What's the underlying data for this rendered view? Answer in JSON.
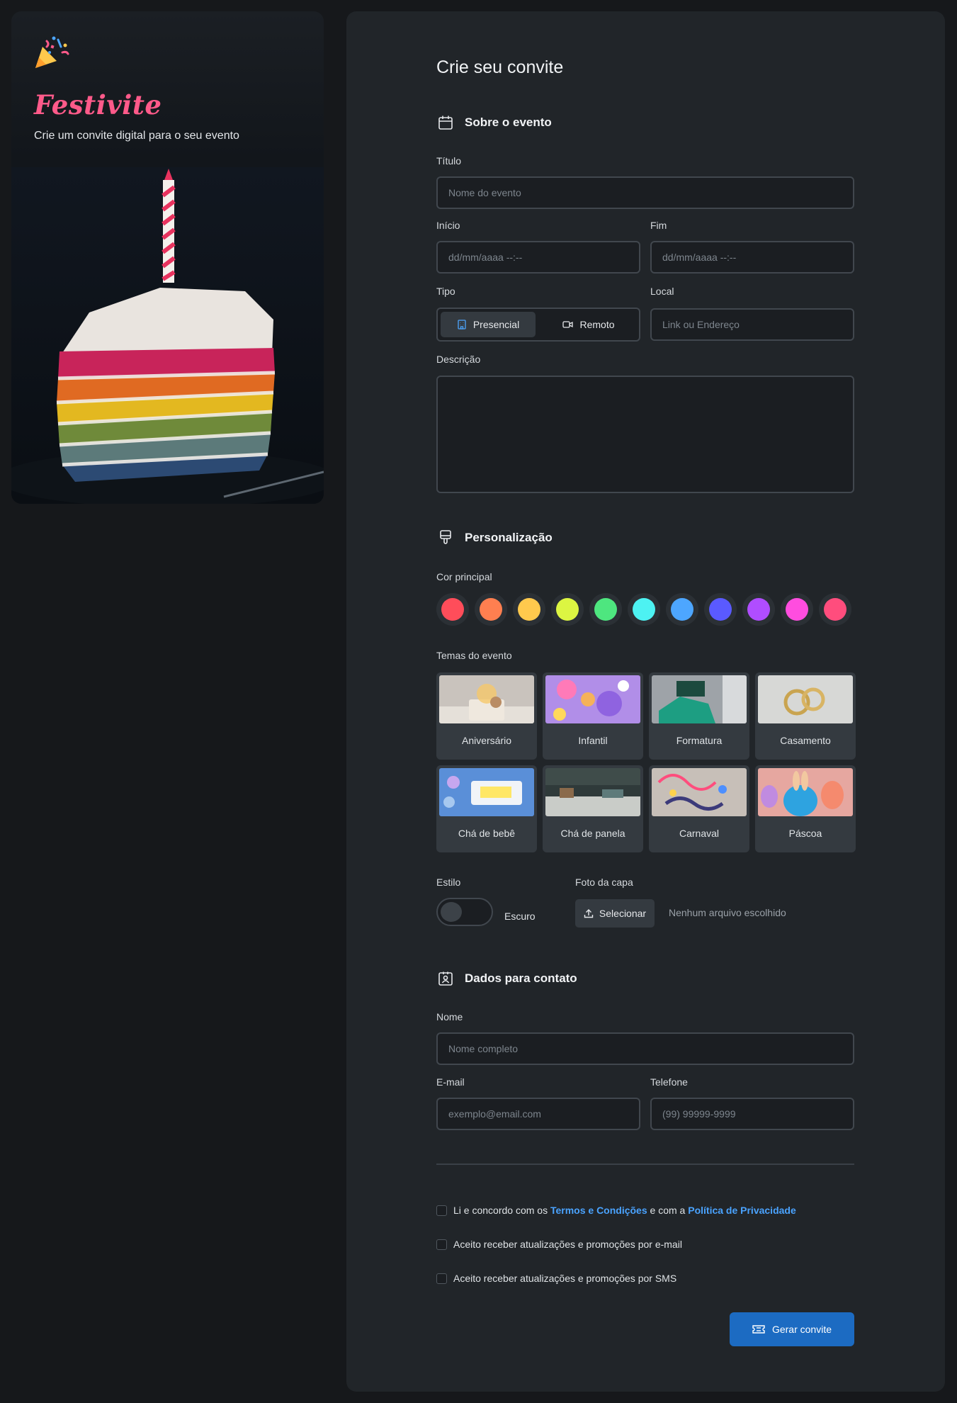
{
  "brand": {
    "name": "Festivite",
    "tagline": "Crie um convite digital para o seu evento",
    "logo_icon": "party-popper-icon",
    "accent": "#ff5a8a"
  },
  "form": {
    "title": "Crie seu convite"
  },
  "about": {
    "heading": "Sobre o evento",
    "icon": "calendar-icon",
    "title_label": "Título",
    "title_placeholder": "Nome do evento",
    "start_label": "Início",
    "start_placeholder": "dd/mm/aaaa --:--",
    "end_label": "Fim",
    "end_placeholder": "dd/mm/aaaa --:--",
    "type_label": "Tipo",
    "type_options": [
      "Presencial",
      "Remoto"
    ],
    "type_selected": "Presencial",
    "location_label": "Local",
    "location_placeholder": "Link ou Endereço",
    "description_label": "Descrição"
  },
  "customization": {
    "heading": "Personalização",
    "icon": "paintbrush-icon",
    "color_label": "Cor principal",
    "colors": [
      "#ff4d5a",
      "#ff7f50",
      "#ffc94d",
      "#dcf542",
      "#4ee67f",
      "#4df2f2",
      "#4da6ff",
      "#5a5aff",
      "#b04dff",
      "#ff4ddf",
      "#ff4d7d"
    ],
    "themes_label": "Temas do evento",
    "themes": [
      "Aniversário",
      "Infantil",
      "Formatura",
      "Casamento",
      "Chá de bebê",
      "Chá de panela",
      "Carnaval",
      "Páscoa"
    ],
    "style_label": "Estilo",
    "style_value": "Escuro",
    "cover_label": "Foto da capa",
    "cover_button": "Selecionar",
    "cover_status": "Nenhum arquivo escolhido"
  },
  "contact": {
    "heading": "Dados para contato",
    "icon": "contact-card-icon",
    "name_label": "Nome",
    "name_placeholder": "Nome completo",
    "email_label": "E-mail",
    "email_placeholder": "exemplo@email.com",
    "phone_label": "Telefone",
    "phone_placeholder": "(99) 99999-9999"
  },
  "terms": {
    "prefix": "Li e concordo com os",
    "terms_link": "Termos e Condições",
    "middle": "e com a",
    "privacy_link": "Política de Privacidade",
    "email_optin": "Aceito receber atualizações e promoções por e-mail",
    "sms_optin": "Aceito receber atualizações e promoções por SMS"
  },
  "submit": {
    "label": "Gerar convite",
    "icon": "ticket-icon",
    "color": "#1c6bc2"
  }
}
